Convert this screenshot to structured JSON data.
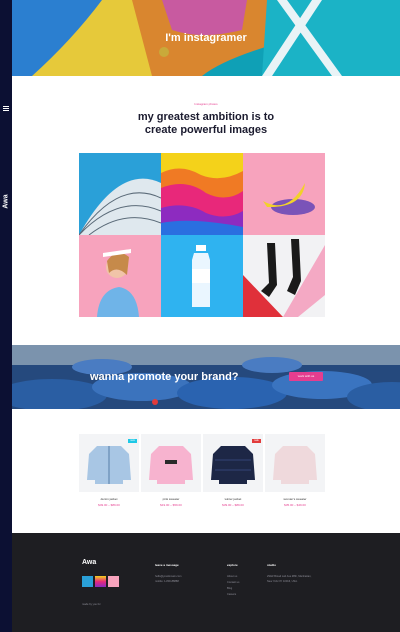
{
  "sidebar": {
    "logo": "Awa"
  },
  "hero": {
    "title": "I'm instagramer"
  },
  "intro": {
    "eyebrow": "Instagram photos",
    "headline_line1": "my greatest ambition is to",
    "headline_line2": "create powerful images"
  },
  "promo": {
    "title": "wanna promote your brand?",
    "button": "work with us"
  },
  "products": [
    {
      "name": "denim jacket",
      "price": "$49.00 – $89.00",
      "badge": "new",
      "badge_color": "#1ec8e6"
    },
    {
      "name": "pink sweater",
      "price": "$19.00 – $59.00",
      "badge": "",
      "badge_color": ""
    },
    {
      "name": "winter jacket",
      "price": "$39.00 – $89.00",
      "badge": "sale",
      "badge_color": "#e23b3b"
    },
    {
      "name": "woman's sweater",
      "price": "$35.00 – $49.00",
      "badge": "",
      "badge_color": ""
    }
  ],
  "footer": {
    "brand": "Awa",
    "copyright": "made by you for",
    "col1_title": "leave a message",
    "col1_lines": [
      "hello@youdomain.com",
      "mobile: 1-800-88888"
    ],
    "col2_title": "explore",
    "col2_lines": [
      "About us",
      "Contact us",
      "Blog",
      "Careers"
    ],
    "col3_title": "studio",
    "col3_lines": [
      "29AR Broad Lab Ave #8th, Manhattan,",
      "New York NY 10016, USA."
    ]
  },
  "colors": {
    "accent": "#e53d8f",
    "sidebar": "#0c1033",
    "footer": "#1e1e22"
  }
}
